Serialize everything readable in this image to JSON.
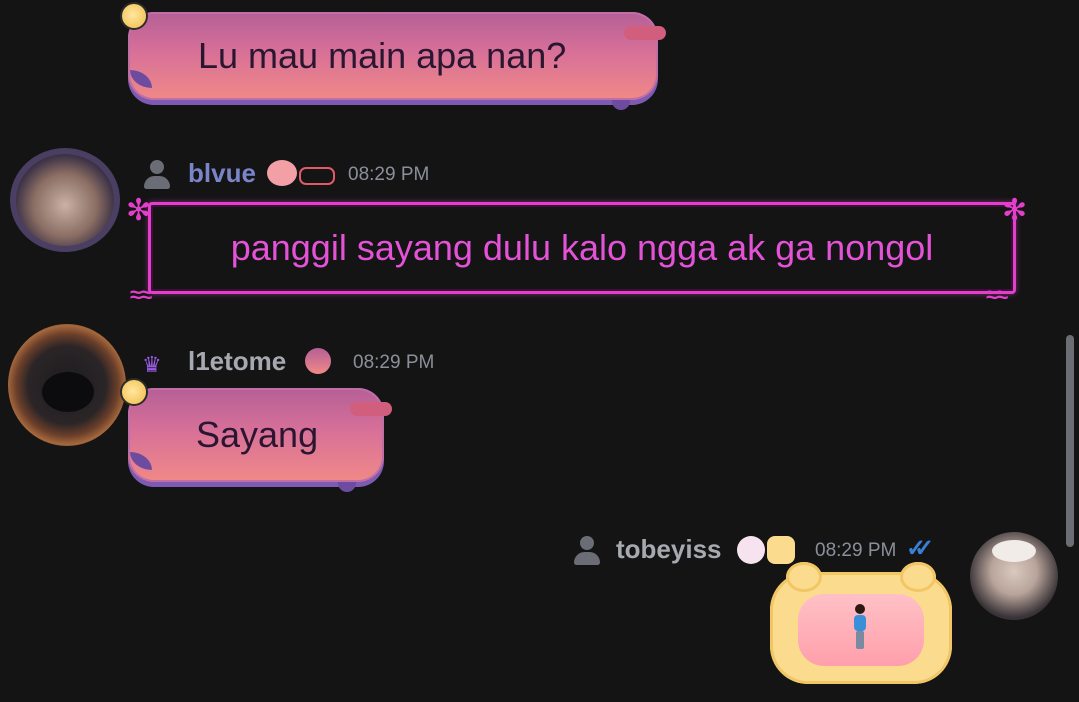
{
  "messages": [
    {
      "id": "m0",
      "text": "Lu mau main apa nan?"
    },
    {
      "id": "m1",
      "username": "blvue",
      "time": "08:29 PM",
      "text": "panggil sayang dulu kalo ngga ak ga nongol"
    },
    {
      "id": "m2",
      "username": "l1etome",
      "time": "08:29 PM",
      "text": "Sayang"
    },
    {
      "id": "m3",
      "username": "tobeyiss",
      "time": "08:29 PM",
      "sticker": "person-emoji",
      "read_status": "double-check"
    }
  ],
  "colors": {
    "background": "#141415",
    "username_blvue": "#7a84c9",
    "username_default": "#a7a9b0",
    "neon": "#e33fcb",
    "timestamp": "#8b8f99",
    "read_ticks": "#3a7fd6"
  }
}
